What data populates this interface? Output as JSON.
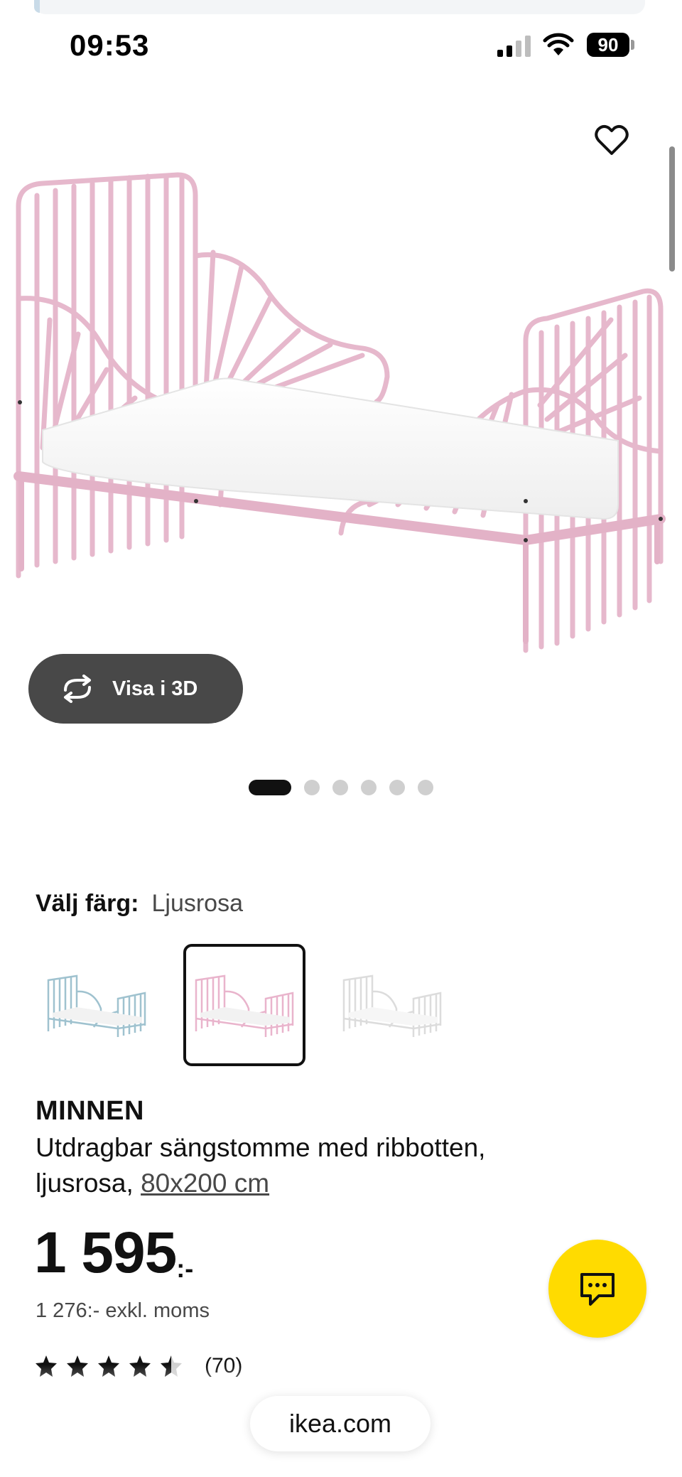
{
  "status_bar": {
    "time": "09:53",
    "battery": "90"
  },
  "hero": {
    "view_3d_label": "Visa i 3D",
    "carousel_count": 6,
    "carousel_active_index": 0
  },
  "color_select": {
    "label": "Välj färg:",
    "selected": "Ljusrosa",
    "options": [
      "light-blue",
      "light-pink",
      "white"
    ],
    "colors": {
      "light-blue": "#9fc2cf",
      "light-pink": "#e9b4cc",
      "white": "#e2e2e2"
    }
  },
  "product": {
    "name": "MINNEN",
    "description": "Utdragbar sängstomme med ribbotten, ljusrosa,",
    "size_link": "80x200 cm",
    "price": "1 595",
    "price_suffix": ":-",
    "price_ex_vat": "1 276:- exkl. moms",
    "rating_stars": 4.5,
    "rating_count": "(70)"
  },
  "browser": {
    "url": "ikea.com"
  },
  "icons": {
    "favorite": "heart-icon",
    "view_3d": "rotate-3d-icon",
    "chat": "chat-icon"
  }
}
